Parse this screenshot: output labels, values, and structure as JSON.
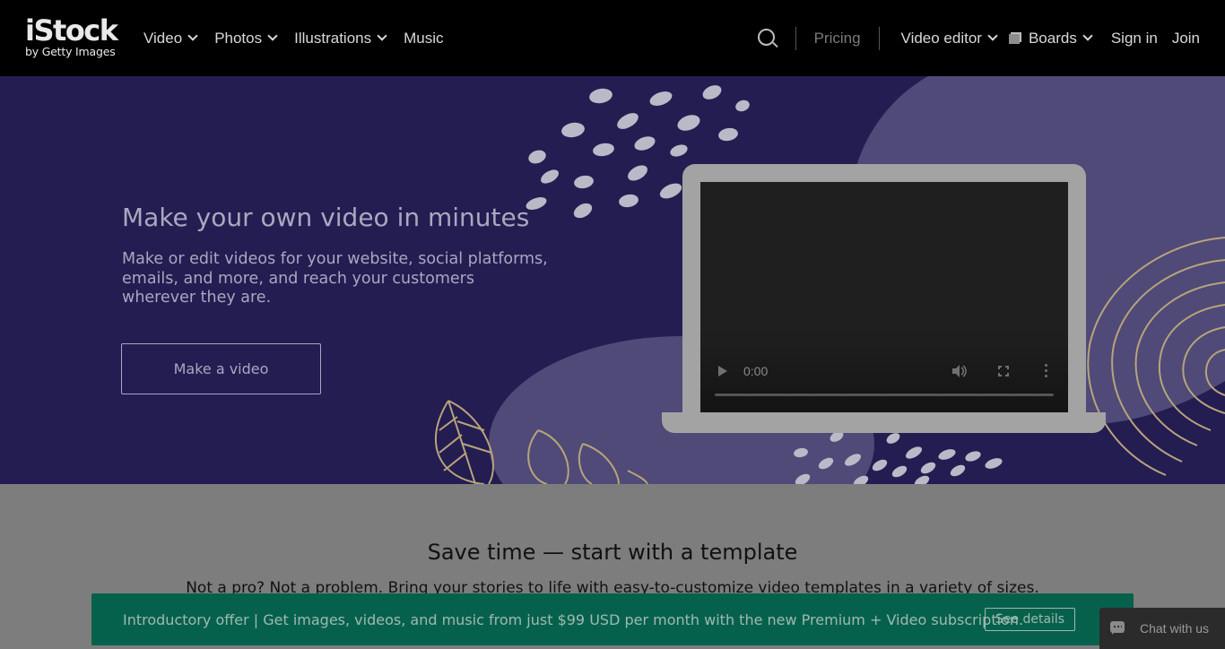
{
  "header": {
    "logo_brand": "iStock",
    "logo_sub": "by Getty Images",
    "nav_left": [
      {
        "label": "Video",
        "dropdown": true
      },
      {
        "label": "Photos",
        "dropdown": true
      },
      {
        "label": "Illustrations",
        "dropdown": true
      },
      {
        "label": "Music",
        "dropdown": false
      }
    ],
    "pricing": "Pricing",
    "video_editor": "Video editor",
    "boards": "Boards",
    "sign_in": "Sign in",
    "join": "Join"
  },
  "hero": {
    "title": "Make your own video in minutes",
    "description": "Make or edit videos for your website, social platforms, emails, and more, and reach your customers wherever they are.",
    "cta": "Make a video",
    "video_time": "0:00"
  },
  "templates": {
    "title": "Save time — start with a template",
    "subtitle": "Not a pro? Not a problem. Bring your stories to life with easy-to-customize video templates in a variety of sizes."
  },
  "promo": {
    "text": "Introductory offer | Get images, videos, and music from just $99 USD per month with the new Premium + Video subscription.",
    "button": "See details"
  },
  "chat": {
    "label": "Chat with us"
  },
  "colors": {
    "header_bg": "#000000",
    "hero_bg": "#231d52",
    "hero_blob": "#4f4a78",
    "promo_bg": "#06614c",
    "overlay_text": "#a9a8bf"
  }
}
